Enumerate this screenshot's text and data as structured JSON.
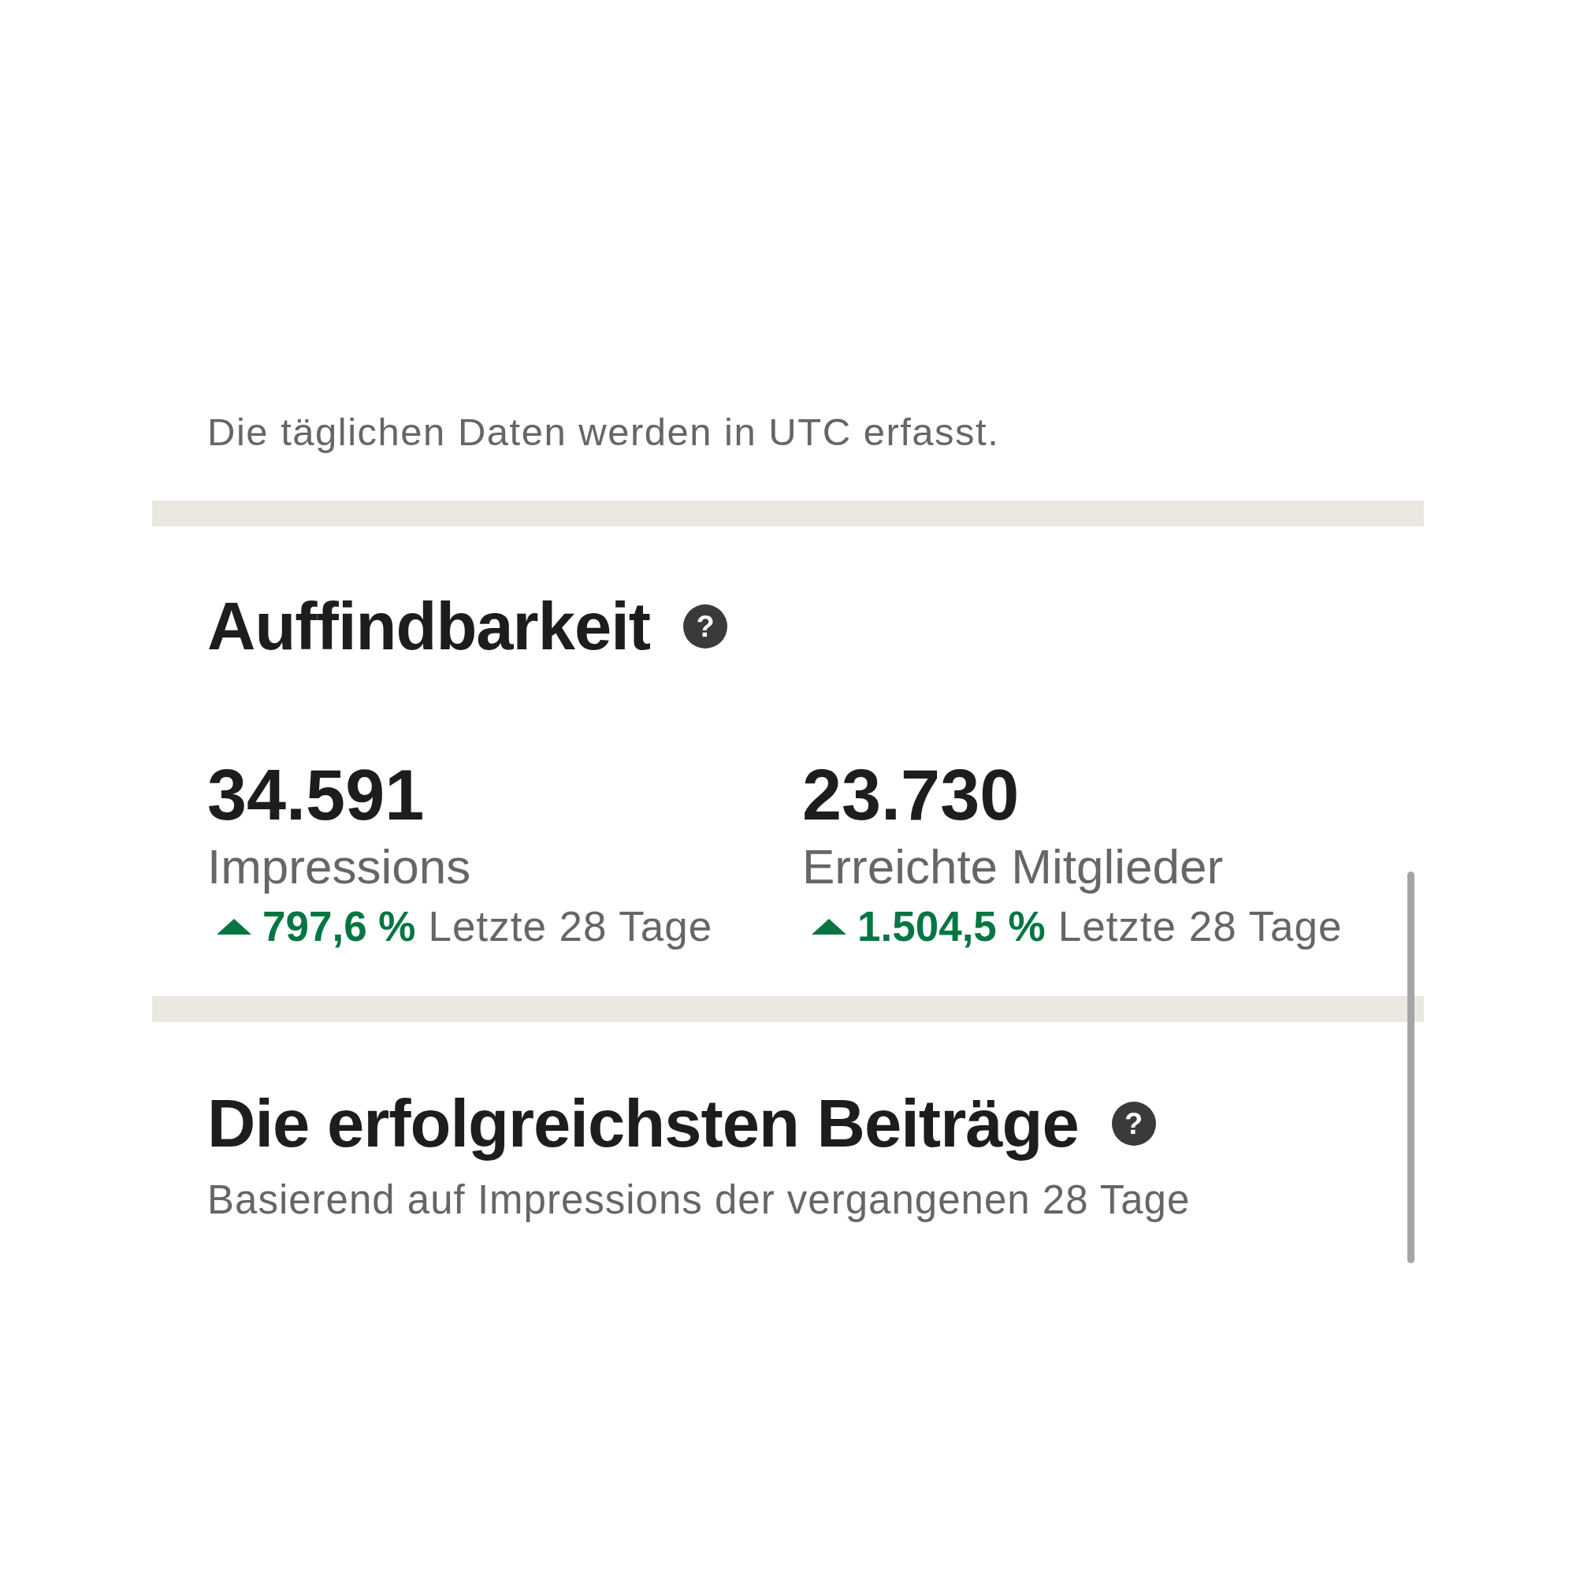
{
  "note": "Die täglichen Daten werden in UTC erfasst.",
  "discoverability": {
    "title": "Auffindbarkeit",
    "help": "?",
    "stats": [
      {
        "value": "34.591",
        "label": "Impressions",
        "change": "797,6 %",
        "period": "Letzte 28 Tage"
      },
      {
        "value": "23.730",
        "label": "Erreichte Mitglieder",
        "change": "1.504,5 %",
        "period": "Letzte 28 Tage"
      }
    ]
  },
  "top_posts": {
    "title": "Die erfolgreichsten Beiträge",
    "help": "?",
    "subtitle": "Basierend auf Impressions der vergangenen 28 Tage"
  }
}
